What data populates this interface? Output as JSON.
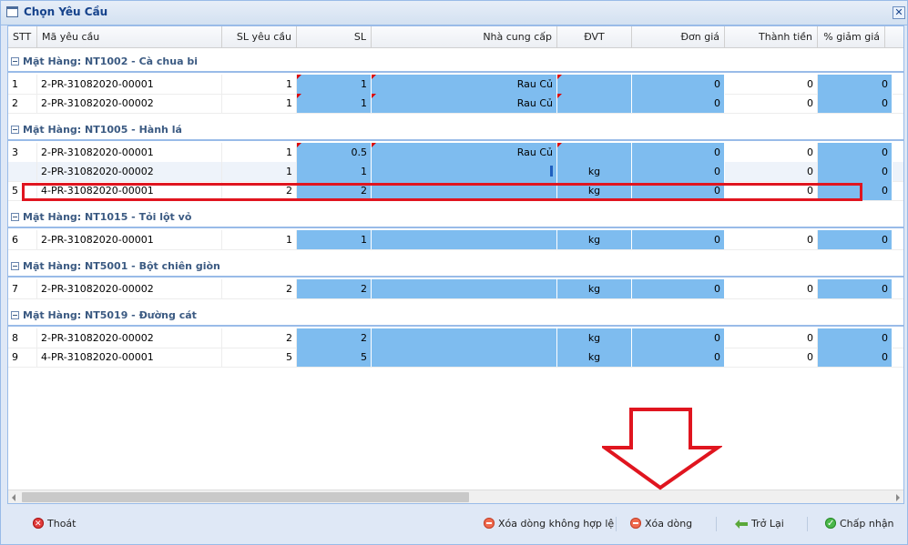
{
  "window": {
    "title": "Chọn Yêu Cầu",
    "close_icon": "close-icon"
  },
  "columns": {
    "stt": "STT",
    "ma_yeu_cau": "Mã yêu cầu",
    "sl_yeu_cau": "SL yêu cầu",
    "sl": "SL",
    "nha_cung_cap": "Nhà cung cấp",
    "dvt": "ĐVT",
    "don_gia": "Đơn giá",
    "thanh_tien": "Thành tiền",
    "giam_gia": "% giảm giá"
  },
  "groups": [
    {
      "label": "Mặt Hàng: NT1002 - Cà chua bi",
      "rows": [
        {
          "stt": "1",
          "ma": "2-PR-31082020-00001",
          "sl_yc": "1",
          "sl": "1",
          "ncc": "Rau Củ",
          "dvt": "",
          "don_gia": "0",
          "thanh_tien": "0",
          "giam_gia": "0"
        },
        {
          "stt": "2",
          "ma": "2-PR-31082020-00002",
          "sl_yc": "1",
          "sl": "1",
          "ncc": "Rau Củ",
          "dvt": "",
          "don_gia": "0",
          "thanh_tien": "0",
          "giam_gia": "0"
        }
      ]
    },
    {
      "label": "Mặt Hàng: NT1005 - Hành lá",
      "rows": [
        {
          "stt": "3",
          "ma": "2-PR-31082020-00001",
          "sl_yc": "1",
          "sl": "0.5",
          "ncc": "Rau Củ",
          "dvt": "",
          "don_gia": "0",
          "thanh_tien": "0",
          "giam_gia": "0"
        },
        {
          "stt": "",
          "ma": "2-PR-31082020-00002",
          "sl_yc": "1",
          "sl": "1",
          "ncc": "",
          "dvt": "kg",
          "don_gia": "0",
          "thanh_tien": "0",
          "giam_gia": "0"
        },
        {
          "stt": "5",
          "ma": "4-PR-31082020-00001",
          "sl_yc": "2",
          "sl": "2",
          "ncc": "",
          "dvt": "kg",
          "don_gia": "0",
          "thanh_tien": "0",
          "giam_gia": "0"
        }
      ]
    },
    {
      "label": "Mặt Hàng: NT1015 - Tỏi lột vỏ",
      "rows": [
        {
          "stt": "6",
          "ma": "2-PR-31082020-00001",
          "sl_yc": "1",
          "sl": "1",
          "ncc": "",
          "dvt": "kg",
          "don_gia": "0",
          "thanh_tien": "0",
          "giam_gia": "0"
        }
      ]
    },
    {
      "label": "Mặt Hàng: NT5001 - Bột chiên giòn",
      "rows": [
        {
          "stt": "7",
          "ma": "2-PR-31082020-00002",
          "sl_yc": "2",
          "sl": "2",
          "ncc": "",
          "dvt": "kg",
          "don_gia": "0",
          "thanh_tien": "0",
          "giam_gia": "0"
        }
      ]
    },
    {
      "label": "Mặt Hàng: NT5019 - Đường cát",
      "rows": [
        {
          "stt": "8",
          "ma": "2-PR-31082020-00002",
          "sl_yc": "2",
          "sl": "2",
          "ncc": "",
          "dvt": "kg",
          "don_gia": "0",
          "thanh_tien": "0",
          "giam_gia": "0"
        },
        {
          "stt": "9",
          "ma": "4-PR-31082020-00001",
          "sl_yc": "5",
          "sl": "5",
          "ncc": "",
          "dvt": "kg",
          "don_gia": "0",
          "thanh_tien": "0",
          "giam_gia": "0"
        }
      ]
    }
  ],
  "buttons": {
    "thoat": "Thoát",
    "xoa_khong_hop_le": "Xóa dòng không hợp lệ",
    "xoa_dong": "Xóa dòng",
    "tro_lai": "Trở Lại",
    "chap_nhan": "Chấp nhận"
  },
  "colors": {
    "editable_cell": "#7ebcef",
    "highlight": "#e0151f",
    "group_text": "#3b5a82"
  }
}
